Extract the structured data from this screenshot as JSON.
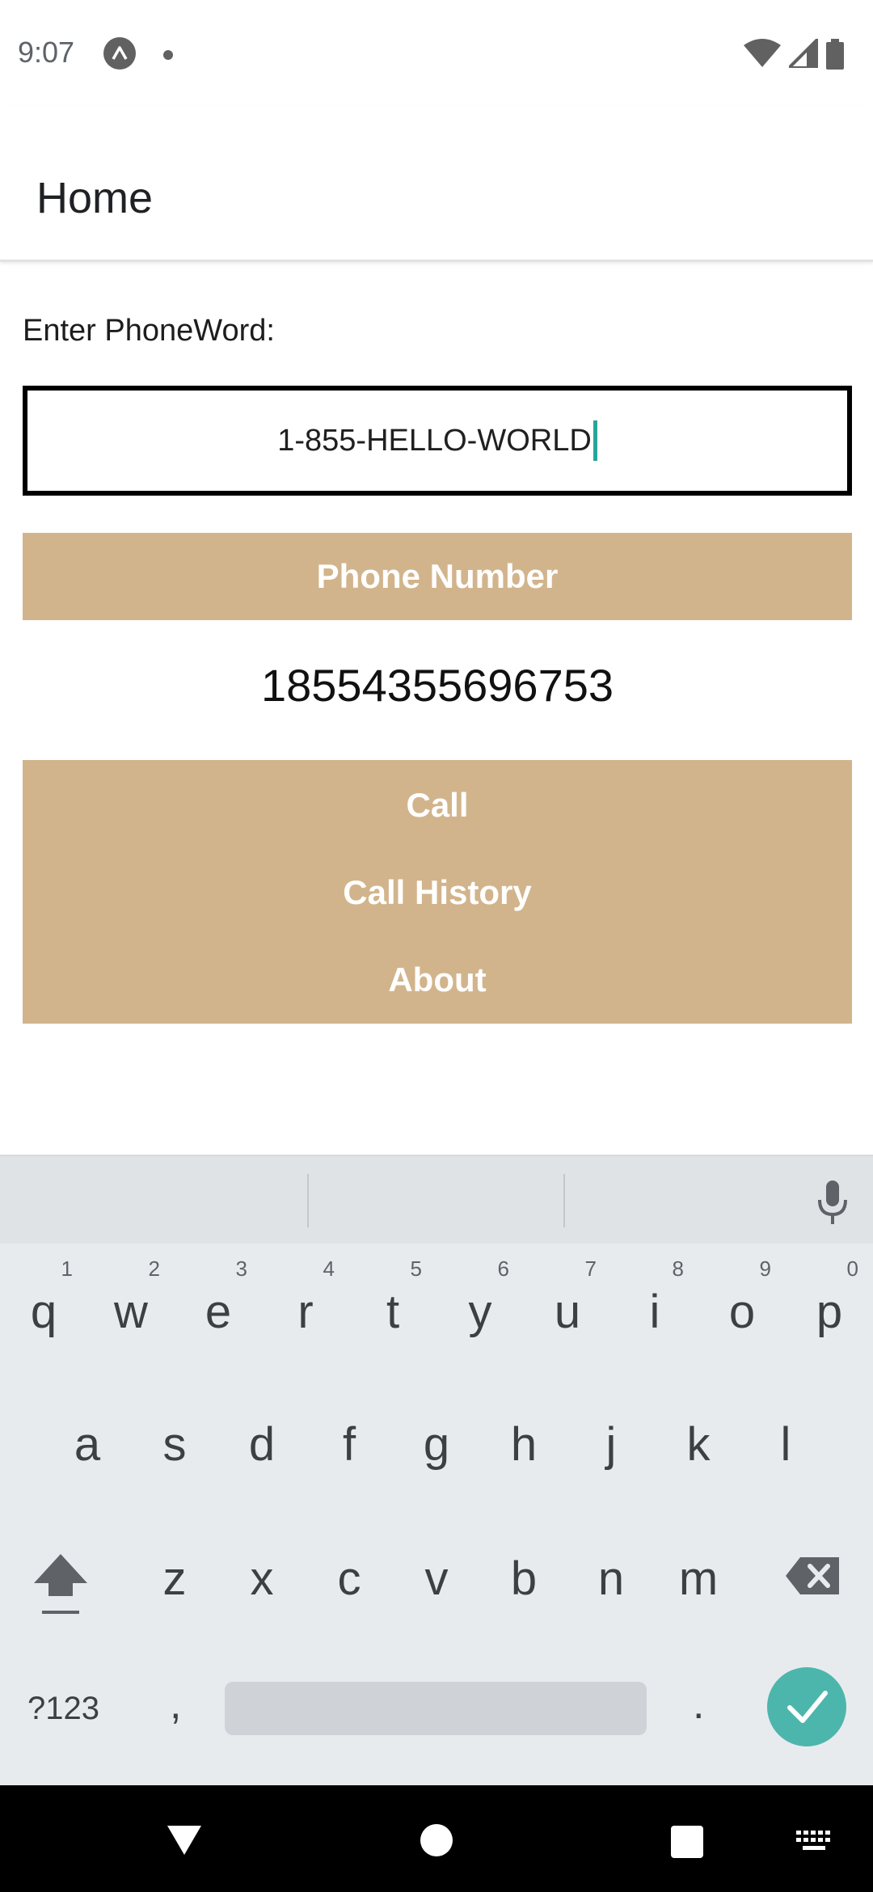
{
  "status_bar": {
    "time": "9:07",
    "icons": [
      "app-notification-icon",
      "dot-icon",
      "wifi-icon",
      "signal-icon",
      "battery-icon"
    ]
  },
  "app_bar": {
    "title": "Home"
  },
  "main": {
    "prompt_label": "Enter PhoneWord:",
    "phoneword_value": "1-855-HELLO-WORLD",
    "phone_number_button": "Phone Number",
    "translated_number": "18554355696753",
    "call_button": "Call",
    "call_history_button": "Call History",
    "about_button": "About",
    "button_color": "#d2b48c"
  },
  "keyboard": {
    "row1": [
      {
        "key": "q",
        "hint": "1"
      },
      {
        "key": "w",
        "hint": "2"
      },
      {
        "key": "e",
        "hint": "3"
      },
      {
        "key": "r",
        "hint": "4"
      },
      {
        "key": "t",
        "hint": "5"
      },
      {
        "key": "y",
        "hint": "6"
      },
      {
        "key": "u",
        "hint": "7"
      },
      {
        "key": "i",
        "hint": "8"
      },
      {
        "key": "o",
        "hint": "9"
      },
      {
        "key": "p",
        "hint": "0"
      }
    ],
    "row2": [
      "a",
      "s",
      "d",
      "f",
      "g",
      "h",
      "j",
      "k",
      "l"
    ],
    "row3": [
      "z",
      "x",
      "c",
      "v",
      "b",
      "n",
      "m"
    ],
    "symbols_key": "?123",
    "comma_key": ",",
    "period_key": ".",
    "accent_color": "#4db6ac"
  },
  "nav_bar": {
    "icons": [
      "back-icon",
      "home-icon",
      "recents-icon",
      "keyboard-switch-icon"
    ]
  }
}
